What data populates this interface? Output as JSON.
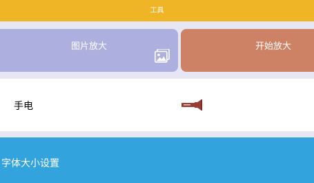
{
  "header": {
    "title": "工具",
    "color": "#efb526"
  },
  "zoom_card": {
    "label": "图片放大",
    "icon": "image-icon",
    "color": "#adb0df"
  },
  "start_card": {
    "label": "开始放大",
    "color": "#ce8265"
  },
  "flashlight_row": {
    "label": "手电",
    "icon": "flashlight-icon"
  },
  "font_row": {
    "label": "字体大小设置",
    "color": "#33a3dd"
  }
}
